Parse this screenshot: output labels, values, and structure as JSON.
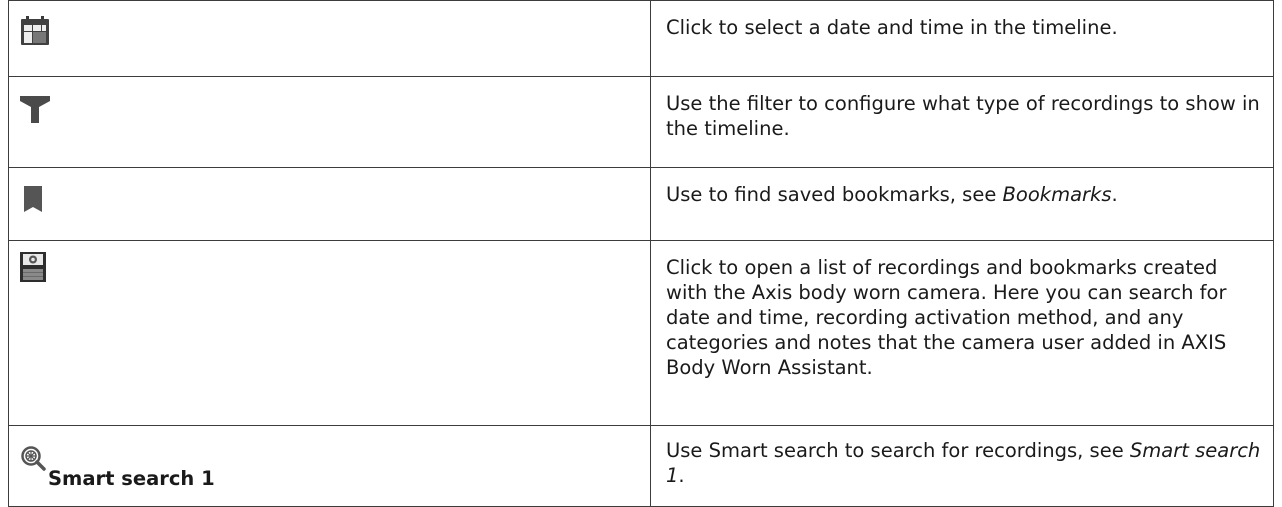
{
  "rows": [
    {
      "icon": "calendar-icon",
      "description": "Click to select a date and time in the timeline."
    },
    {
      "icon": "filter-icon",
      "description": "Use the filter to configure what type of recordings to show in the timeline."
    },
    {
      "icon": "bookmark-icon",
      "description_prefix": "Use to find saved bookmarks, see ",
      "description_link": "Bookmarks",
      "description_suffix": "."
    },
    {
      "icon": "body-worn-recordings-icon",
      "description": "Click to open a list of recordings and bookmarks created with the Axis body worn camera. Here you can search for date and time, recording activation method, and any categories and notes that the camera user added in AXIS Body Worn Assistant."
    },
    {
      "icon": "smart-search-icon",
      "label": "Smart search 1",
      "description_prefix": "Use Smart search to search for recordings, see ",
      "description_link": "Smart search 1",
      "description_suffix": "."
    }
  ]
}
